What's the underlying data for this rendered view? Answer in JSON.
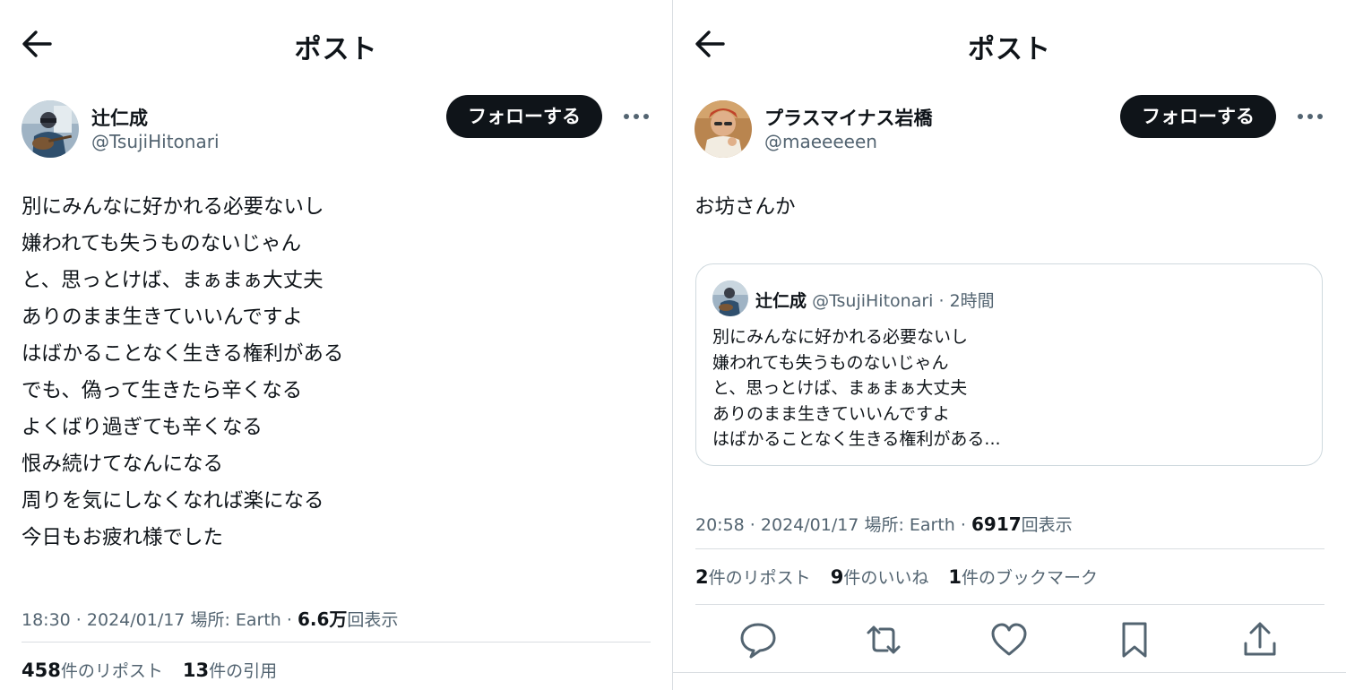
{
  "left": {
    "header_title": "ポスト",
    "author": {
      "name": "辻仁成",
      "handle": "@TsujiHitonari"
    },
    "follow_label": "フォローする",
    "body": "別にみんなに好かれる必要ないし\n嫌われても失うものないじゃん\nと、思っとけば、まぁまぁ大丈夫\nありのまま生きていいんですよ\nはばかることなく生きる権利がある\nでも、偽って生きたら辛くなる\nよくばり過ぎても辛くなる\n恨み続けてなんになる\n周りを気にしなくなれば楽になる\n今日もお疲れ様でした",
    "meta": {
      "time": "18:30",
      "date": "2024/01/17",
      "location": "場所: Earth",
      "views_count": "6.6万",
      "views_label": "回表示"
    },
    "stats": [
      {
        "count": "458",
        "label": "件のリポスト"
      },
      {
        "count": "13",
        "label": "件の引用"
      }
    ]
  },
  "right": {
    "header_title": "ポスト",
    "author": {
      "name": "プラスマイナス岩橋",
      "handle": "@maeeeeen"
    },
    "follow_label": "フォローする",
    "body": "お坊さんか",
    "quote": {
      "name": "辻仁成",
      "handle": "@TsujiHitonari",
      "time": "2時間",
      "text": "別にみんなに好かれる必要ないし\n嫌われても失うものないじゃん\nと、思っとけば、まぁまぁ大丈夫\nありのまま生きていいんですよ\nはばかることなく生きる権利がある..."
    },
    "meta": {
      "time": "20:58",
      "date": "2024/01/17",
      "location": "場所: Earth",
      "views_count": "6917",
      "views_label": "回表示"
    },
    "stats": [
      {
        "count": "2",
        "label": "件のリポスト"
      },
      {
        "count": "9",
        "label": "件のいいね"
      },
      {
        "count": "1",
        "label": "件のブックマーク"
      }
    ],
    "actions": [
      "reply-icon",
      "repost-icon",
      "like-icon",
      "bookmark-icon",
      "share-icon"
    ]
  },
  "colors": {
    "text": "#0f1419",
    "secondary": "#536471",
    "divider": "#d9dde1",
    "button": "#0f1419"
  }
}
